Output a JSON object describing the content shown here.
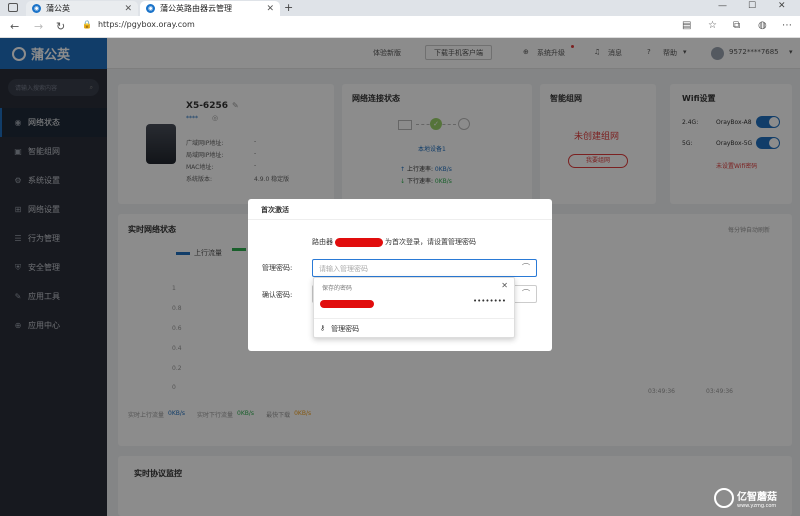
{
  "browser": {
    "tabs": [
      {
        "title": "蒲公英",
        "active": false
      },
      {
        "title": "蒲公英路由器云管理",
        "active": true
      }
    ],
    "url": "https://pgybox.oray.com",
    "new_tab": "+",
    "controls": {
      "minimize": "—",
      "maximize": "☐",
      "close": "✕"
    }
  },
  "app": {
    "logo": "蒲公英",
    "search_placeholder": "请输入搜索内容",
    "menu": [
      {
        "label": "网络状态",
        "icon": "globe-icon",
        "glyph": "◉",
        "active": true
      },
      {
        "label": "智能组网",
        "icon": "network-icon",
        "glyph": "▣",
        "active": false
      },
      {
        "label": "系统设置",
        "icon": "gear-icon",
        "glyph": "⚙",
        "active": false
      },
      {
        "label": "网络设置",
        "icon": "router-icon",
        "glyph": "⊞",
        "active": false
      },
      {
        "label": "行为管理",
        "icon": "behavior-icon",
        "glyph": "☰",
        "active": false
      },
      {
        "label": "安全管理",
        "icon": "shield-icon",
        "glyph": "⛨",
        "active": false
      },
      {
        "label": "应用工具",
        "icon": "tools-icon",
        "glyph": "✎",
        "active": false
      },
      {
        "label": "应用中心",
        "icon": "apps-icon",
        "glyph": "⊕",
        "active": false
      }
    ],
    "topbar": {
      "trial": "体验新版",
      "download": "下载手机客户端",
      "upgrade": "系统升级",
      "messages": "消息",
      "help": "帮助",
      "user": "9572****7685"
    }
  },
  "device_card": {
    "model": "X5-6256",
    "stars": "****",
    "rows": [
      {
        "k": "广域网IP地址:",
        "v": "-"
      },
      {
        "k": "局域网IP地址:",
        "v": "-"
      },
      {
        "k": "MAC地址:",
        "v": "-"
      },
      {
        "k": "系统版本:",
        "v": "4.9.0 稳定版"
      }
    ]
  },
  "network_card": {
    "title": "网络连接状态",
    "local_device": "本地设备1",
    "up_label": "上行速率:",
    "up_value": "0KB/s",
    "down_label": "下行速率:",
    "down_value": "0KB/s"
  },
  "smart_card": {
    "title": "智能组网",
    "status": "未创建组网",
    "button": "我要组网"
  },
  "wifi_card": {
    "title": "Wifi设置",
    "band_24": "2.4G:",
    "ssid_24": "OrayBox-A8",
    "band_5": "5G:",
    "ssid_5": "OrayBox-5G",
    "note": "未设置Wifi密码"
  },
  "realtime_card": {
    "title": "实时网络状态",
    "refresh": "每分钟自动刷新",
    "legend_up": "上行流量",
    "y_ticks": [
      "1",
      "0.8",
      "0.6",
      "0.4",
      "0.2",
      "0"
    ],
    "x_ticks": [
      "03:49:36",
      "03:49:36"
    ],
    "footer_up_label": "实时上行流量",
    "footer_up": "0KB/s",
    "footer_down_label": "实时下行流量",
    "footer_down": "0KB/s",
    "footer_max_label": "最快下载",
    "footer_max": "0KB/s"
  },
  "protocol_card": {
    "title": "实时协议监控"
  },
  "dialog": {
    "title": "首次激活",
    "msg_prefix": "路由器",
    "msg_suffix": "为首次登录，请设置管理密码",
    "pwd_label": "管理密码:",
    "pwd_placeholder": "请输入管理密码",
    "confirm_label": "确认密码:"
  },
  "autofill": {
    "header": "保存的密码",
    "saved_dots": "••••••••",
    "manage": "管理密码"
  },
  "watermark": {
    "brand": "亿智蘑菇",
    "site": "www.yzmg.com"
  },
  "colors": {
    "accent": "#1f6fbf",
    "sidebar": "#2b2f3a",
    "danger": "#e13c3c",
    "success": "#2fae4f"
  }
}
